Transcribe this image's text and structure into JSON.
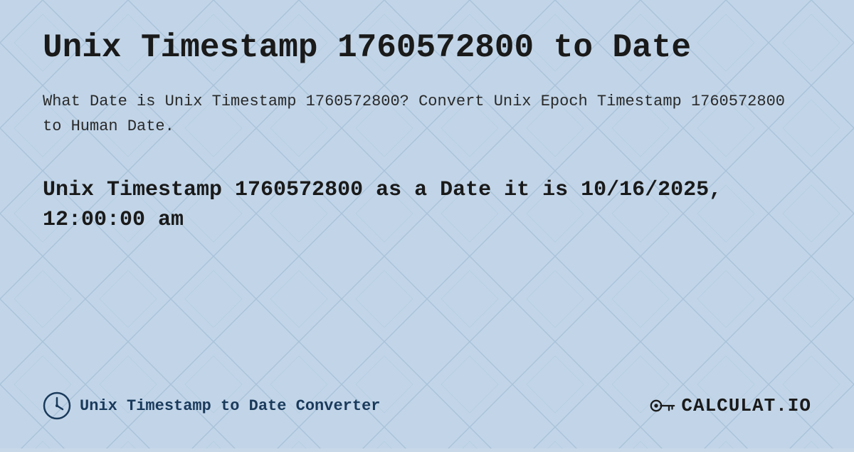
{
  "page": {
    "title": "Unix Timestamp 1760572800 to Date",
    "description": "What Date is Unix Timestamp 1760572800? Convert Unix Epoch Timestamp 1760572800 to Human Date.",
    "result": "Unix Timestamp 1760572800 as a Date it is 10/16/2025, 12:00:00 am",
    "background_color": "#b8cfe0"
  },
  "footer": {
    "link_text": "Unix Timestamp to Date Converter",
    "logo_text": "CALCULAT.IO"
  }
}
